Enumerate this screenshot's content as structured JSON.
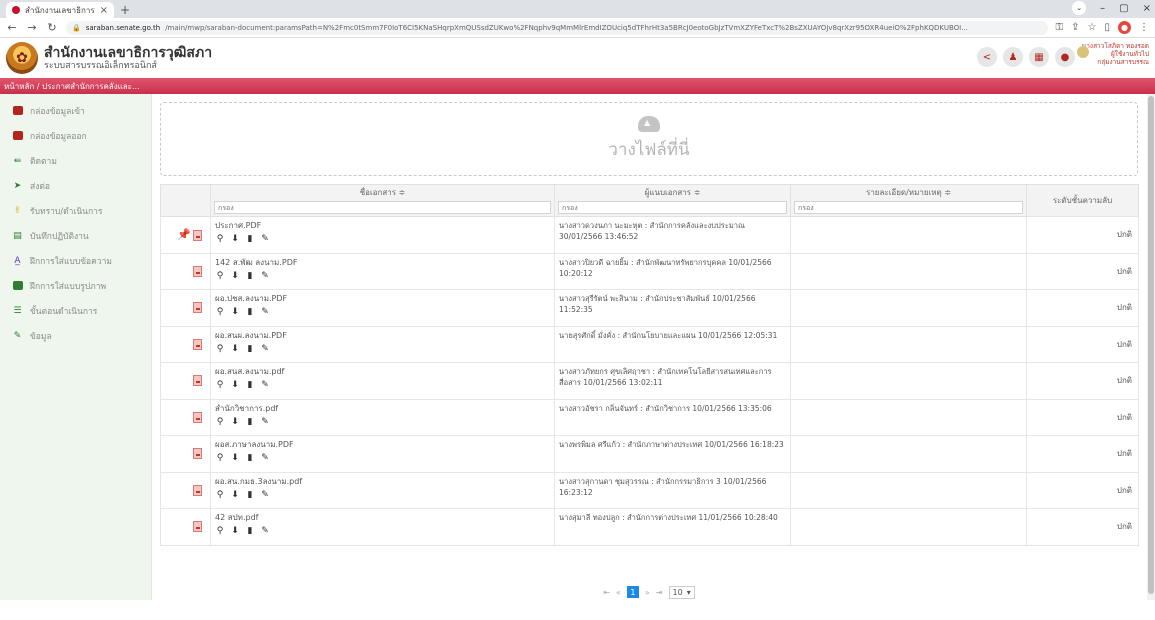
{
  "browser": {
    "tab_title": "สำนักงานเลขาธิการวุฒิสภา",
    "tab_close": "×",
    "new_tab": "+",
    "win_controls": [
      "⌄",
      "–",
      "▢",
      "×"
    ],
    "url_domain": "saraban.senate.go.th",
    "url_path": "/main/mwp/saraban-document:paramsPath=N%2Fmc0tSmm7F0IoT6CI5KNaSHqrpXmQUSsdZUKwo%2FNqphv9qMmMlrEmdIZOUciq5dTFhrHt3a5BRcJ0eotoGbJzTVmXZYFeTxcT%2BsZXUAYOJv8qrXzr95OXR4ueiO%2FphKQDKUBOI..."
  },
  "header": {
    "title": "สำนักงานเลขาธิการวุฒิสภา",
    "subtitle": "ระบบสารบรรณอิเล็กทรอนิกส์",
    "user_name": "นางสาวโสภิดา ทองรอด",
    "user_role": "ผู้ใช้งานทั่วไป",
    "user_group": "กลุ่มงานสารบรรณ"
  },
  "breadcrumb": "หน้าหลัก / ประกาศสำนักการคลังและ...",
  "sidebar": {
    "items": [
      {
        "label": "กล่องข้อมูลเข้า"
      },
      {
        "label": "กล่องข้อมูลออก"
      },
      {
        "label": "ติดตาม"
      },
      {
        "label": "ส่งต่อ"
      },
      {
        "label": "รับทราบ/ดำเนินการ"
      },
      {
        "label": "บันทึกปฏิบัติงาน"
      },
      {
        "label": "ฝึกการใส่แบบข้อความ"
      },
      {
        "label": "ฝึกการใส่แบบรูปภาพ"
      },
      {
        "label": "ขั้นตอนดำเนินการ"
      },
      {
        "label": "ข้อมูล"
      }
    ]
  },
  "dropzone_text": "วางไฟล์ที่นี่",
  "table": {
    "columns": [
      "ชื่อเอกสาร ≑",
      "ผู้แนบเอกสาร ≑",
      "รายละเอียด/หมายเหตุ ≑",
      "ระดับชั้นความลับ"
    ],
    "filter_placeholder": "กรอง",
    "rows": [
      {
        "file": "ประกาศ.PDF",
        "sender": "นางสาวดวงนภา นะมะหุต : สำนักการคลังและงบประมาณ 30/01/2566 13:46:52",
        "note": "",
        "level": "ปกติ"
      },
      {
        "file": "142 ส.พัฒ ลงนาม.PDF",
        "sender": "นางสาวปิยวดี ฉายยิ้ม : สำนักพัฒนาทรัพยากรบุคคล 10/01/2566 10:20:12",
        "note": "",
        "level": "ปกติ"
      },
      {
        "file": "ผอ.ปชส.ลงนาม.PDF",
        "sender": "นางสาวสุรีรัตน์ พะสินาม : สำนักประชาสัมพันธ์ 10/01/2566 11:52:35",
        "note": "",
        "level": "ปกติ"
      },
      {
        "file": "ผอ.สนผ.ลงนาม.PDF",
        "sender": "นายสุรศักดิ์ มั่งคั่ง : สำนักนโยบายและแผน 10/01/2566 12:05:31",
        "note": "",
        "level": "ปกติ"
      },
      {
        "file": "ผอ.สนส.ลงนาม.pdf",
        "sender": "นางสาวภัทยกร ศุขเลิศฤาชา : สำนักเทคโนโลยีสารสนเทศและการสื่อสาร 10/01/2566 13:02:11",
        "note": "",
        "level": "ปกติ"
      },
      {
        "file": "สำนักวิชาการ.pdf",
        "sender": "นางสาวอัชรา กลิ่นจันทร์ : สำนักวิชาการ 10/01/2566 13:35:06",
        "note": "",
        "level": "ปกติ"
      },
      {
        "file": "ผอส.ภาษาลงนาม.PDF",
        "sender": "นางพรพิมล ศรีแก้ว : สำนักภาษาต่างประเทศ 10/01/2566 16:18:23",
        "note": "",
        "level": "ปกติ"
      },
      {
        "file": "ผอ.สน.กมธ.3ลงนาม.pdf",
        "sender": "นางสาวสุกานดา ชุมสุวรรณ : สำนักกรรมาธิการ 3 10/01/2566 16:23:12",
        "note": "",
        "level": "ปกติ"
      },
      {
        "file": "42 สปท.pdf",
        "sender": "นางสุมาลี ทองปลูก : สำนักการต่างประเทศ 11/01/2566 10:28:40",
        "note": "",
        "level": "ปกติ"
      }
    ]
  },
  "pager": {
    "first": "⇤",
    "prev": "«",
    "current_page": "1",
    "next": "»",
    "last": "⇥",
    "page_size": "10"
  }
}
